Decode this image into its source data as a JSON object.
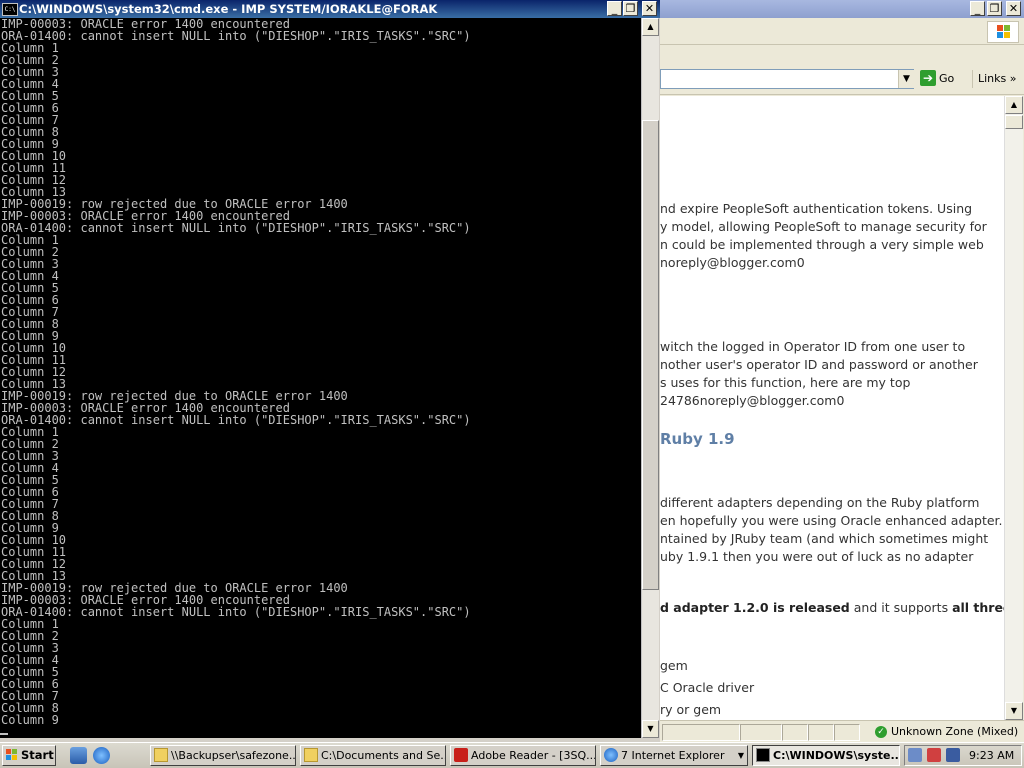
{
  "cmd_window": {
    "title": "C:\\WINDOWS\\system32\\cmd.exe - IMP SYSTEM/IORAKLE@FORAK",
    "icon_label": "C:\\",
    "lines": [
      "IMP-00003: ORACLE error 1400 encountered",
      "ORA-01400: cannot insert NULL into (\"DIESHOP\".\"IRIS_TASKS\".\"SRC\")",
      "Column 1",
      "Column 2",
      "Column 3",
      "Column 4",
      "Column 5",
      "Column 6",
      "Column 7",
      "Column 8",
      "Column 9",
      "Column 10",
      "Column 11",
      "Column 12",
      "Column 13",
      "IMP-00019: row rejected due to ORACLE error 1400",
      "IMP-00003: ORACLE error 1400 encountered",
      "ORA-01400: cannot insert NULL into (\"DIESHOP\".\"IRIS_TASKS\".\"SRC\")",
      "Column 1",
      "Column 2",
      "Column 3",
      "Column 4",
      "Column 5",
      "Column 6",
      "Column 7",
      "Column 8",
      "Column 9",
      "Column 10",
      "Column 11",
      "Column 12",
      "Column 13",
      "IMP-00019: row rejected due to ORACLE error 1400",
      "IMP-00003: ORACLE error 1400 encountered",
      "ORA-01400: cannot insert NULL into (\"DIESHOP\".\"IRIS_TASKS\".\"SRC\")",
      "Column 1",
      "Column 2",
      "Column 3",
      "Column 4",
      "Column 5",
      "Column 6",
      "Column 7",
      "Column 8",
      "Column 9",
      "Column 10",
      "Column 11",
      "Column 12",
      "Column 13",
      "IMP-00019: row rejected due to ORACLE error 1400",
      "IMP-00003: ORACLE error 1400 encountered",
      "ORA-01400: cannot insert NULL into (\"DIESHOP\".\"IRIS_TASKS\".\"SRC\")",
      "Column 1",
      "Column 2",
      "Column 3",
      "Column 4",
      "Column 5",
      "Column 6",
      "Column 7",
      "Column 8",
      "Column 9"
    ],
    "controls": {
      "minimize": "_",
      "restore": "❐",
      "close": "✕"
    },
    "colors": {
      "background": "#000000",
      "text": "#c0c0c0",
      "titlebar": "#0a246a"
    }
  },
  "browser": {
    "controls": {
      "minimize": "_",
      "restore": "❐",
      "close": "✕"
    },
    "go_label": "Go",
    "links_label": "Links",
    "links_chevron": "»",
    "address_value": "",
    "content": [
      {
        "text": "nd expire PeopleSoft authentication tokens. Using",
        "style": "body"
      },
      {
        "text": "y model, allowing PeopleSoft to manage security for",
        "style": "body"
      },
      {
        "text": "n could be implemented through a very simple web",
        "style": "body"
      },
      {
        "text": "noreply@blogger.com0",
        "style": "body"
      },
      {
        "text": "witch the logged in Operator ID from one user to",
        "style": "body"
      },
      {
        "text": "nother user's operator ID and password or another",
        "style": "body"
      },
      {
        "text": "s uses for this function, here are my top",
        "style": "body"
      },
      {
        "text": "24786noreply@blogger.com0",
        "style": "body"
      },
      {
        "text": "Ruby 1.9",
        "style": "head"
      },
      {
        "text": "different adapters depending on the Ruby platform",
        "style": "body"
      },
      {
        "text": "en hopefully you were using Oracle enhanced adapter.",
        "style": "body"
      },
      {
        "text": "ntained by JRuby team (and which sometimes might",
        "style": "body"
      },
      {
        "text": "uby 1.9.1 then you were out of luck as no adapter",
        "style": "body"
      },
      {
        "text": "gem",
        "style": "body"
      },
      {
        "text": "C Oracle driver",
        "style": "body"
      },
      {
        "text": "ry or gem",
        "style": "body"
      }
    ],
    "mixed_line": {
      "part1": "d adapter 1.2.0 is released",
      "part2": " and it supports ",
      "part3": "all three"
    },
    "status": {
      "zone": "Unknown Zone (Mixed)"
    }
  },
  "taskbar": {
    "start_label": "Start",
    "buttons": [
      {
        "label": "\\\\Backupser\\safezone...",
        "icon": "folder-icon"
      },
      {
        "label": "C:\\Documents and Se...",
        "icon": "folder-icon"
      },
      {
        "label": "Adobe Reader - [3SQ...",
        "icon": "adobe-reader-icon"
      },
      {
        "label": "7 Internet Explorer",
        "icon": "ie-icon"
      },
      {
        "label": "C:\\WINDOWS\\syste...",
        "icon": "cmd-icon"
      }
    ],
    "clock": "9:23 AM"
  }
}
